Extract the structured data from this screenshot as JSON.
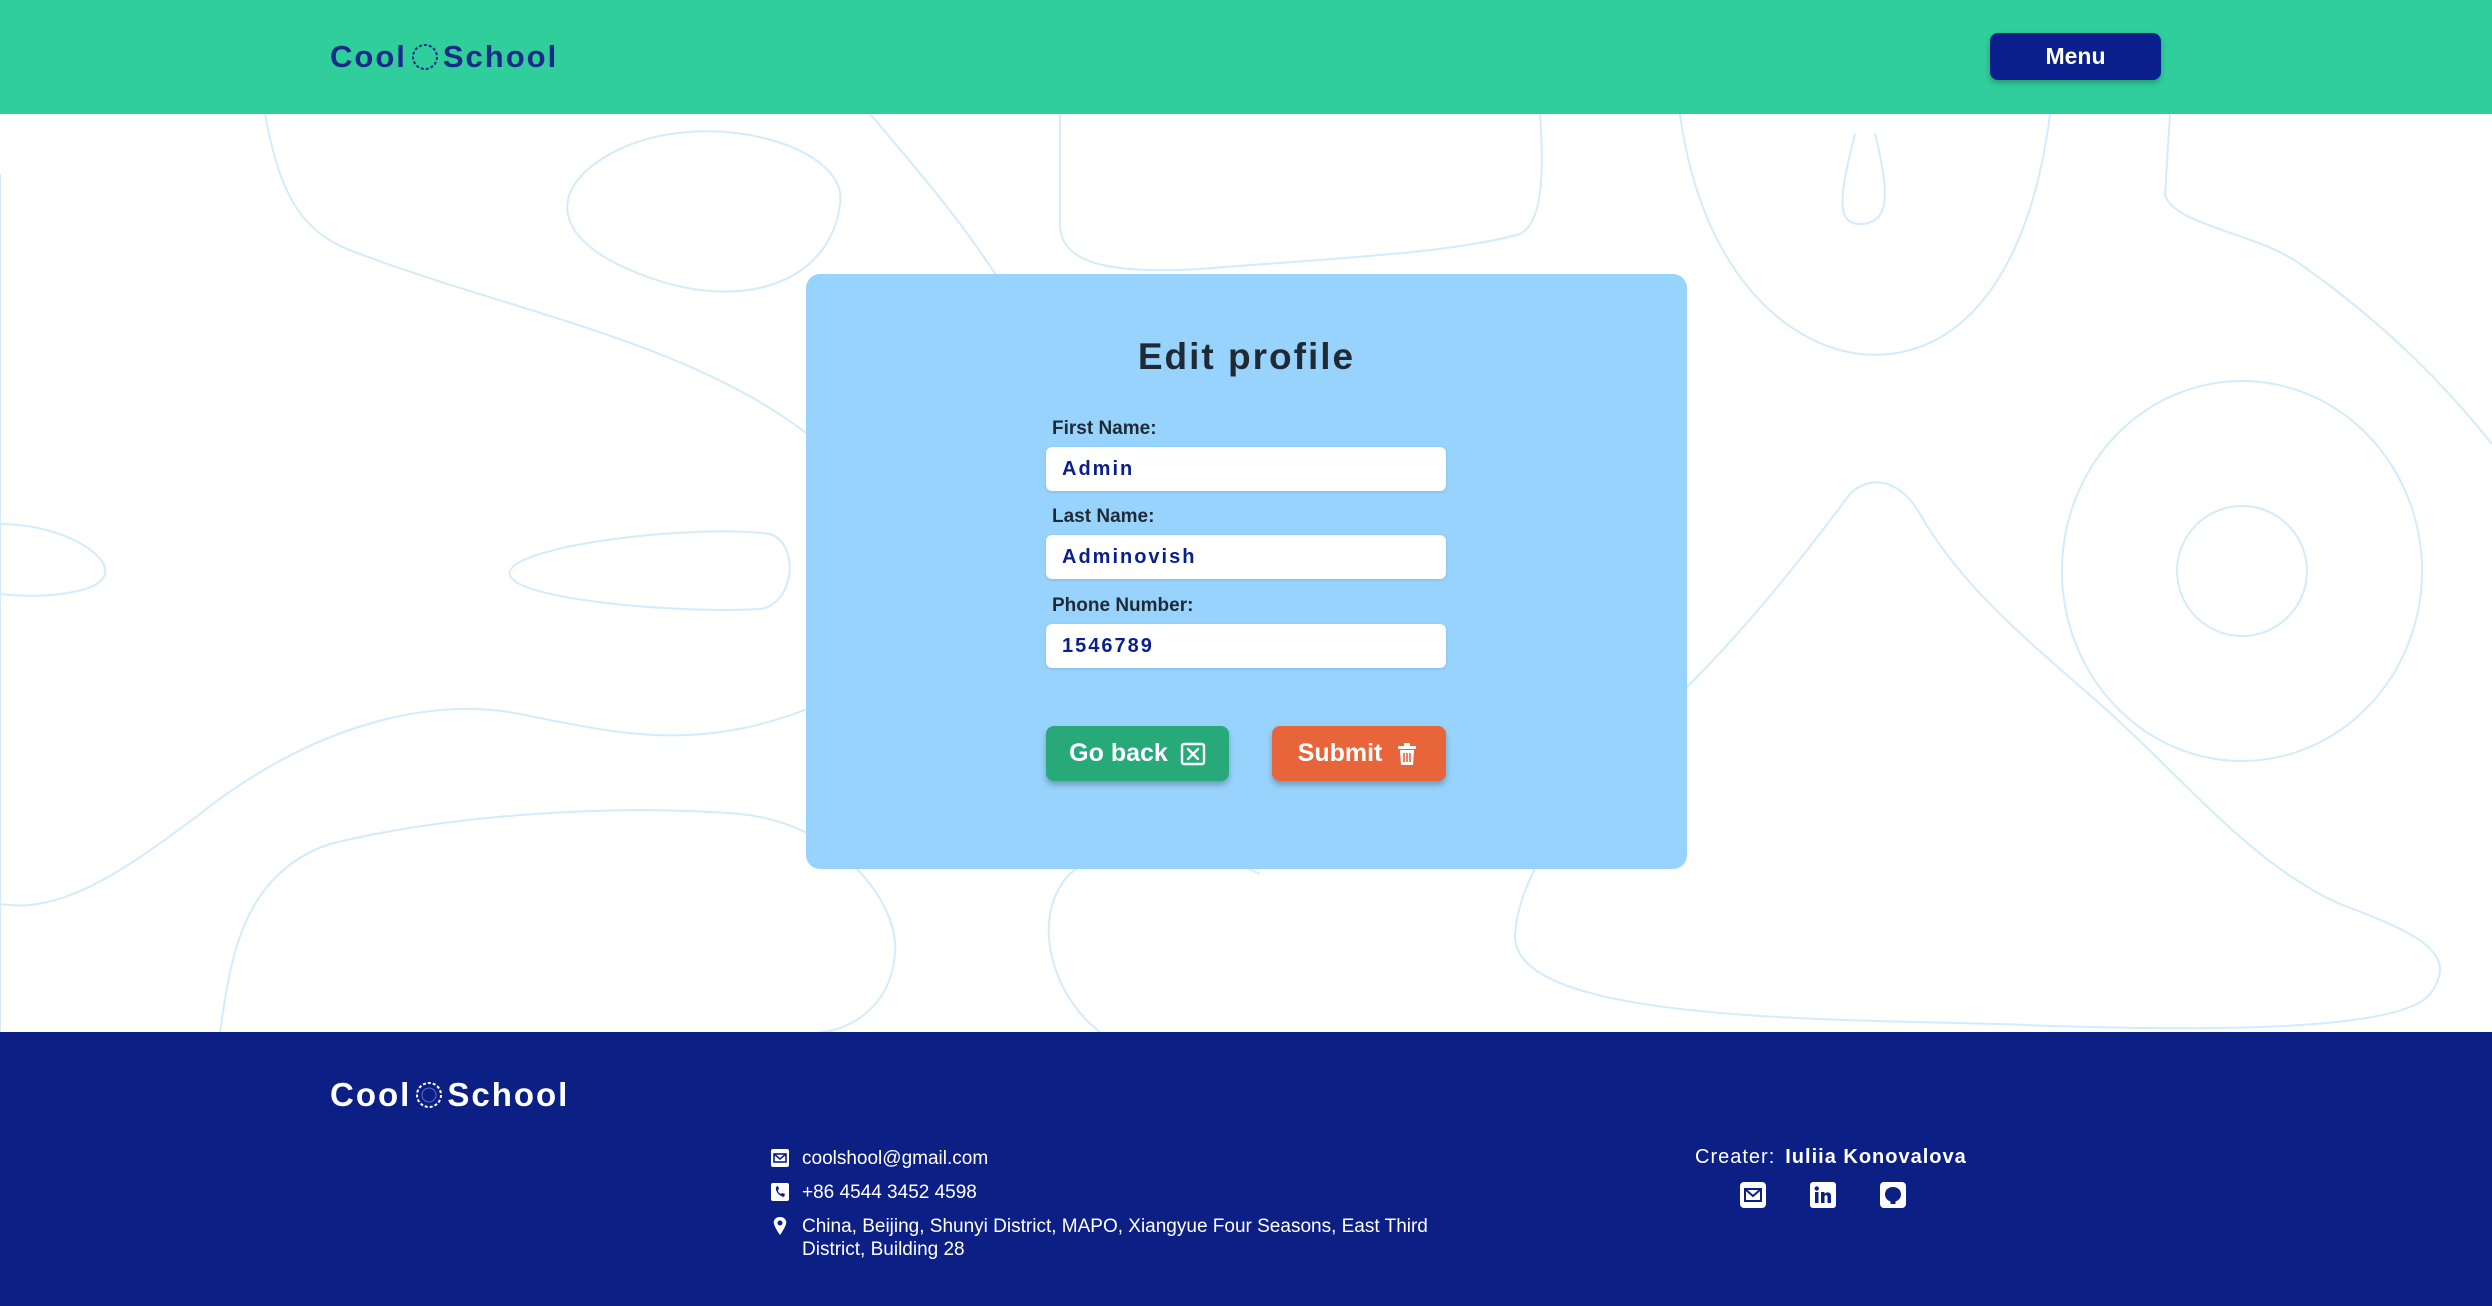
{
  "header": {
    "logo_left": "Cool",
    "logo_right": "School",
    "menu_label": "Menu"
  },
  "form": {
    "title": "Edit profile",
    "fields": [
      {
        "label": "First Name:",
        "value": "Admin"
      },
      {
        "label": "Last Name:",
        "value": "Adminovish"
      },
      {
        "label": "Phone Number:",
        "value": "1546789"
      }
    ],
    "go_back_label": "Go back",
    "submit_label": "Submit"
  },
  "footer": {
    "logo_left": "Cool",
    "logo_right": "School",
    "email": "coolshool@gmail.com",
    "phone": "+86 4544 3452 4598",
    "address": "China, Beijing, Shunyi District, MAPO, Xiangyue Four Seasons, East Third District, Building 28",
    "creator_label": "Creater:",
    "creator_name": "Iuliia Konovalova",
    "social_icons": [
      "mail-icon",
      "linkedin-icon",
      "github-icon"
    ]
  },
  "colors": {
    "header_bg": "#2fce9b",
    "menu_bg": "#0b1f8c",
    "card_bg": "#97d3fc",
    "go_back_bg": "#27a97a",
    "submit_bg": "#e8643a",
    "footer_bg": "#0b1f84",
    "brand_text": "#1a2a8a"
  }
}
